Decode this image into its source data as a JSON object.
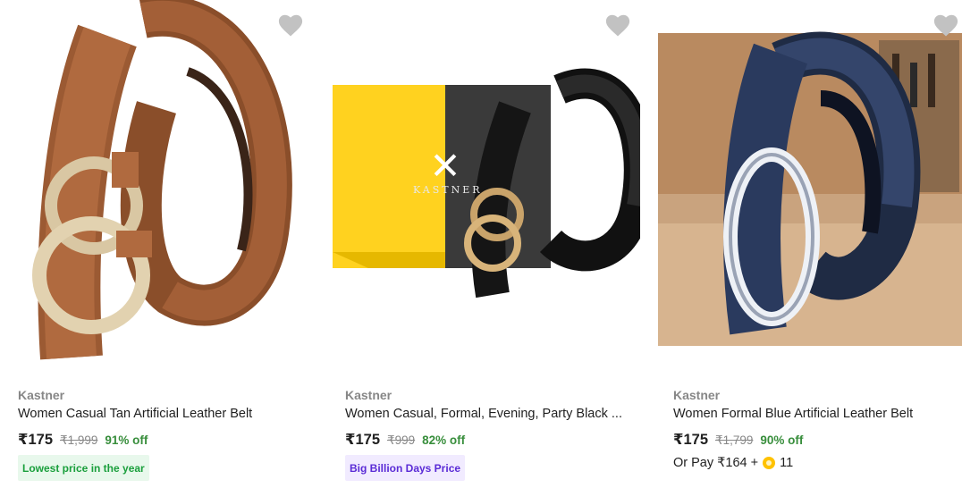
{
  "products": [
    {
      "brand": "Kastner",
      "title": "Women Casual Tan Artificial Leather Belt",
      "price": "₹175",
      "mrp": "₹1,999",
      "discount": "91% off",
      "tag": "Lowest price in the year",
      "tag_color": "#1a9f3c"
    },
    {
      "brand": "Kastner",
      "title": "Women Casual, Formal, Evening, Party Black ...",
      "price": "₹175",
      "mrp": "₹999",
      "discount": "82% off",
      "tag": "Big Billion Days Price",
      "tag_color": "#5a2bd6",
      "box_brand": "KASTNER"
    },
    {
      "brand": "Kastner",
      "title": "Women Formal Blue Artificial Leather Belt",
      "price": "₹175",
      "mrp": "₹1,799",
      "discount": "90% off",
      "or_pay_text": "Or Pay ₹164 +",
      "coins": "11"
    }
  ],
  "colors": {
    "discount": "#388e3c",
    "wishlist": "#c2c2c2",
    "coin": "#ffc200"
  },
  "icons": {
    "wishlist": "heart-icon",
    "supercoin": "coin-icon"
  }
}
